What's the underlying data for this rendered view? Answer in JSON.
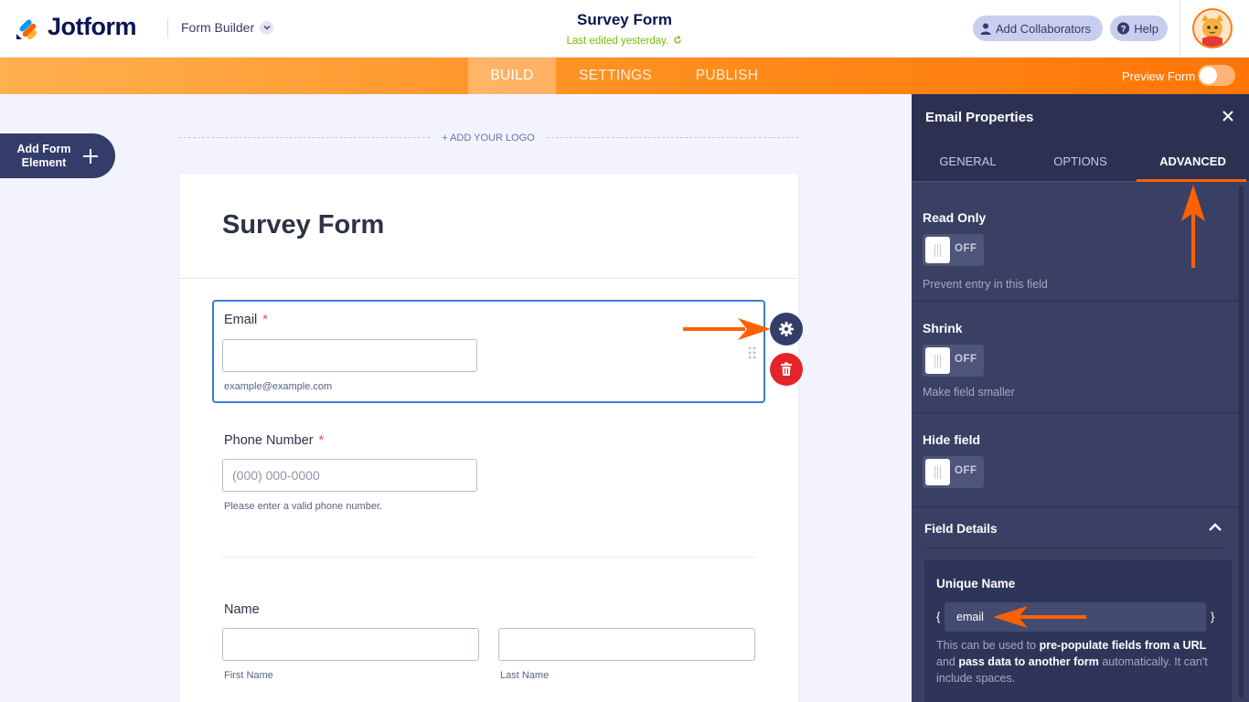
{
  "header": {
    "brand": "Jotform",
    "builder_menu": "Form Builder",
    "form_title": "Survey Form",
    "last_edited": "Last edited yesterday.",
    "add_collaborators": "Add Collaborators",
    "help": "Help"
  },
  "nav": {
    "tabs": [
      "BUILD",
      "SETTINGS",
      "PUBLISH"
    ],
    "active_tab": "BUILD",
    "preview_label": "Preview Form",
    "preview_on": false
  },
  "canvas": {
    "add_element": "Add Form Element",
    "add_logo": "+ ADD YOUR LOGO",
    "form_title": "Survey Form",
    "fields": {
      "email": {
        "label": "Email",
        "required": "*",
        "value": "",
        "sublabel": "example@example.com"
      },
      "phone": {
        "label": "Phone Number",
        "required": "*",
        "placeholder": "(000) 000-0000",
        "sublabel": "Please enter a valid phone number."
      },
      "name": {
        "label": "Name",
        "first_sublabel": "First Name",
        "last_sublabel": "Last Name"
      }
    }
  },
  "panel": {
    "title": "Email Properties",
    "tabs": [
      "GENERAL",
      "OPTIONS",
      "ADVANCED"
    ],
    "active_tab": "ADVANCED",
    "properties": [
      {
        "title": "Read Only",
        "state": "OFF",
        "description": "Prevent entry in this field"
      },
      {
        "title": "Shrink",
        "state": "OFF",
        "description": "Make field smaller"
      },
      {
        "title": "Hide field",
        "state": "OFF",
        "description": ""
      }
    ],
    "field_details": {
      "title": "Field Details",
      "unique_name_label": "Unique Name",
      "unique_name_value": "email",
      "brace_open": "{",
      "brace_close": "}",
      "help_1": "This can be used to ",
      "help_bold_1": "pre-populate fields from a URL",
      "help_2": " and ",
      "help_bold_2": "pass data to another form",
      "help_3": " automatically. It can't include spaces."
    }
  },
  "colors": {
    "accent": "#ff6100",
    "navy": "#0a1551",
    "panel": "#3a4064",
    "selected_border": "#3e7bd4",
    "danger": "#e5242a",
    "edited_green": "#78bb07"
  }
}
